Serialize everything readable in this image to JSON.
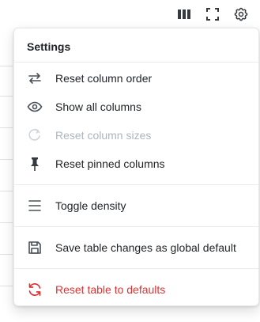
{
  "toolbar": {
    "icons": [
      "columns-icon",
      "fullscreen-icon",
      "settings-gear-icon"
    ]
  },
  "menu": {
    "title": "Settings",
    "items": [
      {
        "label": "Reset column order",
        "icon": "arrows-left-right-icon"
      },
      {
        "label": "Show all columns",
        "icon": "eye-icon"
      },
      {
        "label": "Reset column sizes",
        "icon": "rotate-icon",
        "disabled": true
      },
      {
        "label": "Reset pinned columns",
        "icon": "pin-icon"
      },
      {
        "label": "Toggle density",
        "icon": "density-lines-icon"
      },
      {
        "label": "Save table changes as global default",
        "icon": "floppy-disk-icon"
      },
      {
        "label": "Reset table to defaults",
        "icon": "refresh-icon",
        "danger": true
      }
    ]
  },
  "colors": {
    "danger": "#e03131",
    "disabled": "#adb5bd",
    "text": "#212529"
  }
}
